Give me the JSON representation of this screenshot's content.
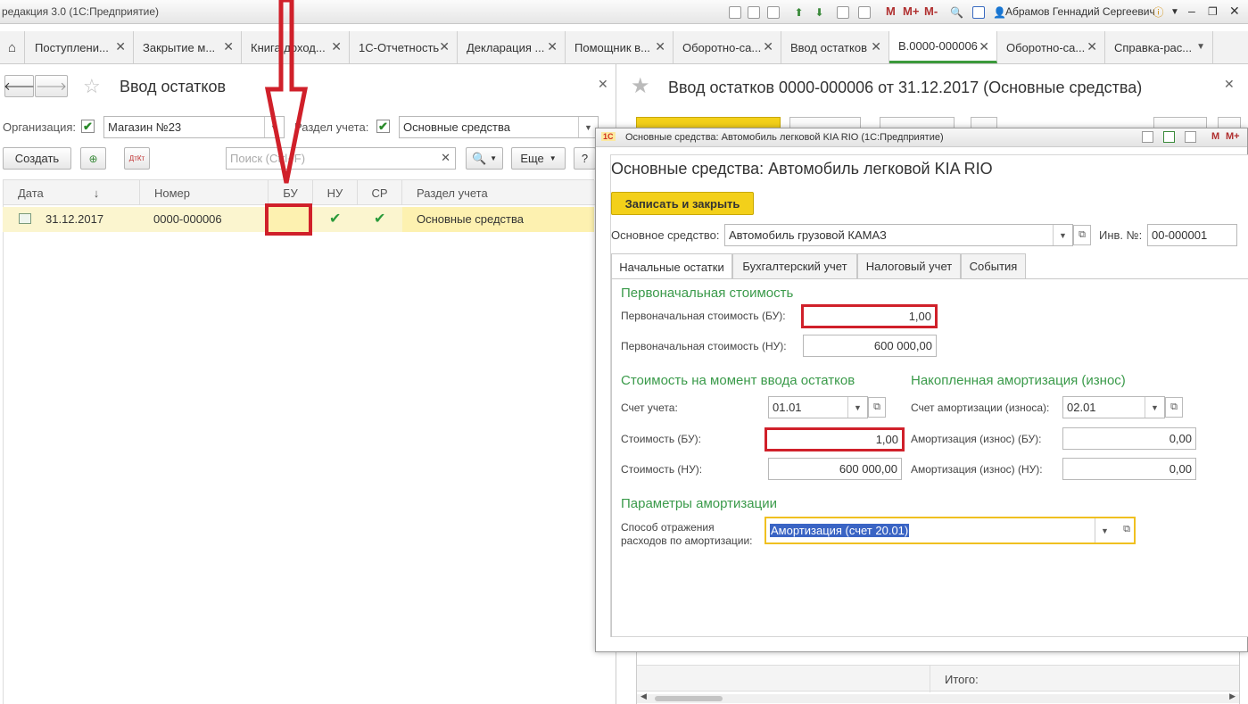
{
  "app": {
    "title": "редакция 3.0  (1С:Предприятие)",
    "user": "Абрамов Геннадий Сергеевич"
  },
  "toolbar": {
    "m": "M",
    "m_plus": "M+",
    "m_minus": "M-"
  },
  "tabs": [
    {
      "label": "Поступлени..."
    },
    {
      "label": "Закрытие м..."
    },
    {
      "label": "Книга доход..."
    },
    {
      "label": "1С-Отчетность"
    },
    {
      "label": "Декларация ..."
    },
    {
      "label": "Помощник в..."
    },
    {
      "label": "Оборотно-са..."
    },
    {
      "label": "Ввод остатков"
    },
    {
      "label": "В.0000-000006"
    },
    {
      "label": "Оборотно-са..."
    },
    {
      "label": "Справка-рас..."
    }
  ],
  "list": {
    "title": "Ввод остатков",
    "org_label": "Организация:",
    "org_value": "Магазин №23",
    "section_label": "Раздел учета:",
    "section_value": "Основные средства",
    "create_label": "Создать",
    "search_placeholder": "Поиск (Ctrl+F)",
    "more_label": "Еще",
    "help_label": "?",
    "columns": {
      "date": "Дата",
      "number": "Номер",
      "bu": "БУ",
      "nu": "НУ",
      "sr": "СР",
      "section": "Раздел учета"
    },
    "rows": [
      {
        "date": "31.12.2017",
        "number": "0000-000006",
        "bu": "",
        "nu": "✔",
        "sr": "✔",
        "section": "Основные средства"
      }
    ]
  },
  "document": {
    "title": "Ввод остатков 0000-000006 от 31.12.2017 (Основные средства)",
    "footer_label": "Итого:"
  },
  "dialog": {
    "window_title": "Основные средства: Автомобиль легковой KIA RIO  (1С:Предприятие)",
    "heading": "Основные средства: Автомобиль легковой KIA RIO",
    "save_close": "Записать и закрыть",
    "asset_label": "Основное средство:",
    "asset_value": "Автомобиль грузовой КАМАЗ",
    "inv_label": "Инв. №:",
    "inv_value": "00-000001",
    "tabs": [
      "Начальные остатки",
      "Бухгалтерский учет",
      "Налоговый учет",
      "События"
    ],
    "initial_cost_section": "Первоначальная стоимость",
    "initial_bu_label": "Первоначальная стоимость (БУ):",
    "initial_bu_value": "1,00",
    "initial_nu_label": "Первоначальная стоимость (НУ):",
    "initial_nu_value": "600 000,00",
    "cost_section": "Стоимость на момент ввода остатков",
    "account_label": "Счет учета:",
    "account_value": "01.01",
    "cost_bu_label": "Стоимость (БУ):",
    "cost_bu_value": "1,00",
    "cost_nu_label": "Стоимость (НУ):",
    "cost_nu_value": "600 000,00",
    "amort_section": "Накопленная амортизация (износ)",
    "amort_account_label": "Счет амортизации (износа):",
    "amort_account_value": "02.01",
    "amort_bu_label": "Амортизация (износ) (БУ):",
    "amort_bu_value": "0,00",
    "amort_nu_label": "Амортизация (износ) (НУ):",
    "amort_nu_value": "0,00",
    "params_section": "Параметры амортизации",
    "method_label_1": "Способ отражения",
    "method_label_2": "расходов по амортизации:",
    "method_value": "Амортизация (счет 20.01)"
  },
  "colors": {
    "accent_green": "#3a9a4a",
    "highlight_red": "#d0202a",
    "button_yellow": "#f3d01a",
    "selected_row": "#fbf5cf"
  }
}
